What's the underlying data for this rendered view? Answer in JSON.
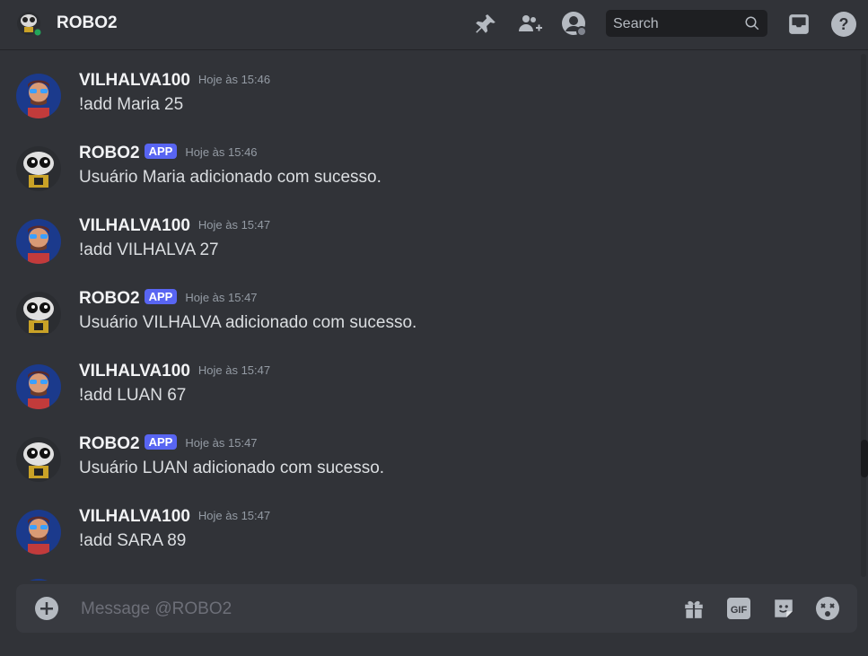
{
  "header": {
    "title": "ROBO2",
    "search_placeholder": "Search",
    "icons": [
      "pin-icon",
      "add-friend-icon",
      "user-profile-icon",
      "search-icon",
      "inbox-icon",
      "help-icon"
    ]
  },
  "messages": [
    {
      "author": "VILHALVA100",
      "bot": false,
      "time": "Hoje às 15:46",
      "content": "!add Maria 25"
    },
    {
      "author": "ROBO2",
      "bot": true,
      "badge": "APP",
      "time": "Hoje às 15:46",
      "content": "Usuário Maria adicionado com sucesso."
    },
    {
      "author": "VILHALVA100",
      "bot": false,
      "time": "Hoje às 15:47",
      "content": "!add VILHALVA 27"
    },
    {
      "author": "ROBO2",
      "bot": true,
      "badge": "APP",
      "time": "Hoje às 15:47",
      "content": "Usuário VILHALVA adicionado com sucesso."
    },
    {
      "author": "VILHALVA100",
      "bot": false,
      "time": "Hoje às 15:47",
      "content": "!add LUAN 67"
    },
    {
      "author": "ROBO2",
      "bot": true,
      "badge": "APP",
      "time": "Hoje às 15:47",
      "content": "Usuário LUAN adicionado com sucesso."
    },
    {
      "author": "VILHALVA100",
      "bot": false,
      "time": "Hoje às 15:47",
      "content": "!add SARA 89"
    }
  ],
  "composer": {
    "placeholder": "Message @ROBO2",
    "icons": [
      "add-attachment-icon",
      "gift-icon",
      "gif-icon",
      "sticker-icon",
      "emoji-icon"
    ]
  },
  "colors": {
    "background": "#313338",
    "header_background": "#313338",
    "composer_background": "#383a40",
    "badge": "#5865f2",
    "online_status": "#23a55a"
  }
}
